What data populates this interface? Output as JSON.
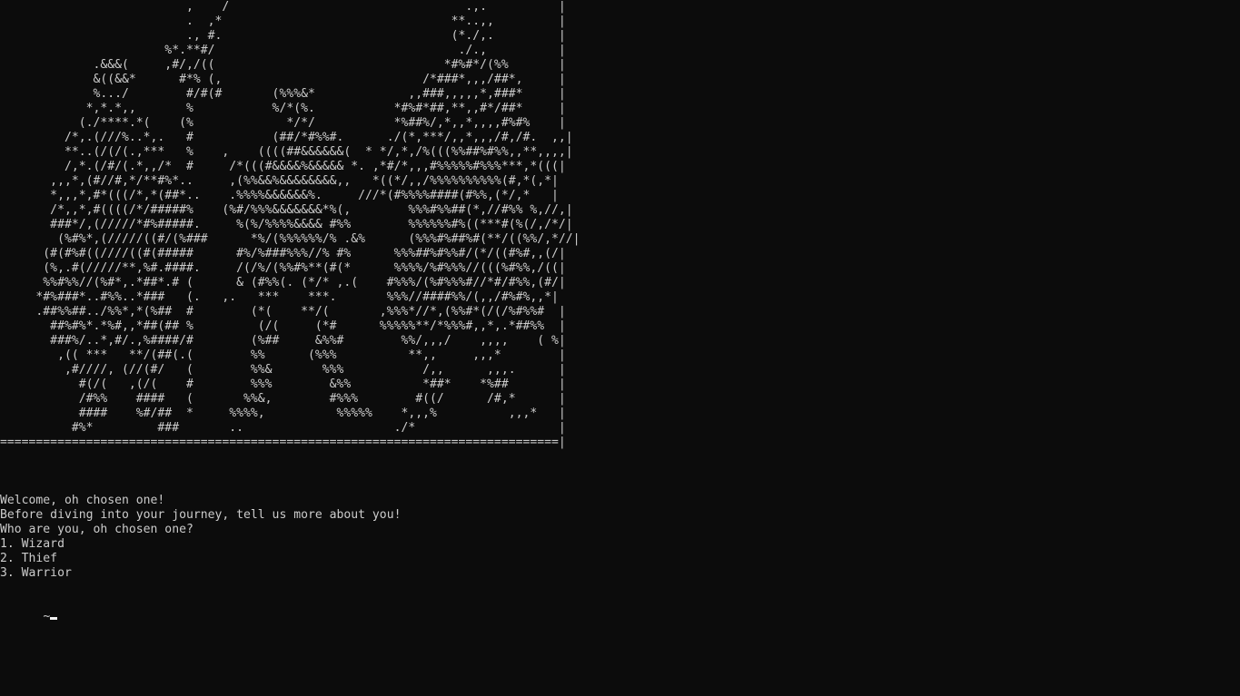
{
  "terminal": {
    "art_lines": [
      "                          ,    /                                 .,.          |",
      "                          .  ,*                                **..,,         |",
      "                          ., #.                                (*./,.         |",
      "                       %*.**#/                                  ./.,          |",
      "             .&&&(     ,#/,/((                                *#%#*/(%%       |",
      "             &((&&*      #*% (,                            /*###*,,,/##*,     |",
      "             %.../        #/#(#       (%%%&*             ,,###,,,,,*,###*     |",
      "            *,*.*,,       %           %/*(%.           *#%#*##,**,,#*/##*     |",
      "           (./****.*(    (%             */*/           *%##%/,*,,*,,,,#%#%    |",
      "         /*,.(///%..*,.   #           (##/*#%%#.      ./(*,***/,,*,,,/#,/#.  ,,|",
      "         **..(/(/(.,***   %    ,    ((((##&&&&&&(  * */,*,/%(((%%##%#%%,,**,,,,|",
      "         /,*.(/#/(.*,,/*  #     /*(((#&&&&%&&&&& *. ,*#/*,,,#%%%%%#%%%***,*(((|",
      "       ,,,*,(#//#,*/**#%*..     ,(%%&&%&&&&&&&&,,   *((*/,,/%%%%%%%%%%(#,*(,*|",
      "       *,,,*,#*(((/*,*(##*..    .%%%%&&&&&&%.     ///*(#%%%%####(#%%,(*/,*   |",
      "       /*,,*,#((((/*/#####%    (%#/%%%&&&&&&&*%(,        %%%#%%##(*,//#%% %,//,|",
      "       ###*/,(/////*#%#####.     %(%/%%%%&&&& #%%        %%%%%%#%((***#(%(/,/*/|",
      "        (%#%*,(/////((#/(%###      *%/(%%%%%%/% .&%      (%%%#%##%#(**/((%%/,*//|",
      "      (#(#%#((////((#(#####      #%/%###%%%//% #%      %%%##%#%%#/(*/((#%#,,(/|",
      "      (%,.#(/////**,%#.####.     /(/%/(%%#%**(#(*      %%%%/%#%%%//(((%#%%,/((|",
      "      %%#%%//(%#*,.*##*.# (      & (#%%(. (*/* ,.(    #%%%/(%#%%%#//*#/#%%,(#/|",
      "     *#%###*..#%%..*###   (.   ,.   ***    ***.       %%%//####%%/(,,/#%#%,,*|",
      "     .##%%##../%%*,*(%##  #        (*(    **/(       ,%%%*//*,(%%#*(/(/%#%%#  |",
      "       ##%#%*.*%#,,*##(## %         (/(     (*#      %%%%%**/*%%%#,,*,.*##%%  |",
      "       ###%/..*,#/.,%####/#        (%##     &%%#        %%/,,,/    ,,,,    ( %|",
      "        ,(( ***   **/(##(.(        %%      (%%%          **,,     ,,,*        |",
      "         ,#////, (//(#/   (        %%&       %%%           /,,      ,,,.      |",
      "           #(/(   ,(/(    #        %%%        &%%          *##*    *%##       |",
      "           /#%%    ####   (       %%&,        #%%%        #((/      /#,*      |",
      "           ####    %#/##  *     %%%%,          %%%%%    *,,,%          ,,,*   |",
      "          #%*         ###       ..                     ./*                    |"
    ],
    "separator": "==============================================================================|",
    "output_lines": [
      "Welcome, oh chosen one!",
      "Before diving into your journey, tell us more about you!",
      "Who are you, oh chosen one?",
      "1. Wizard",
      "2. Thief",
      "3. Warrior",
      ""
    ],
    "prompt_symbol": "~",
    "colors": {
      "background": "#0c0c0c",
      "text": "#cccccc",
      "cursor": "#f2f2f2"
    }
  }
}
